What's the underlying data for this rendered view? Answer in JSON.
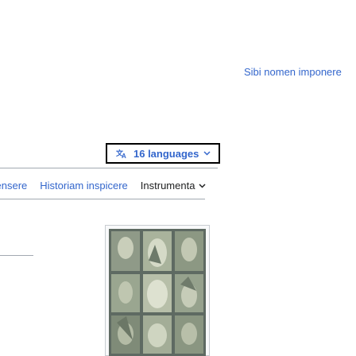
{
  "header": {
    "account_link": "Sibi nomen imponere"
  },
  "language_button": {
    "label": "16 languages",
    "icon": "translate-icon",
    "chevron": "chevron-down-icon"
  },
  "tabs": [
    {
      "label": "censere"
    },
    {
      "label": "Historiam inspicere"
    },
    {
      "label": "Instrumenta"
    }
  ],
  "infobox_image": {
    "icon": "stained-glass-image"
  },
  "colors": {
    "link": "#3366cc",
    "text": "#202122",
    "border": "#a2a9b1"
  }
}
